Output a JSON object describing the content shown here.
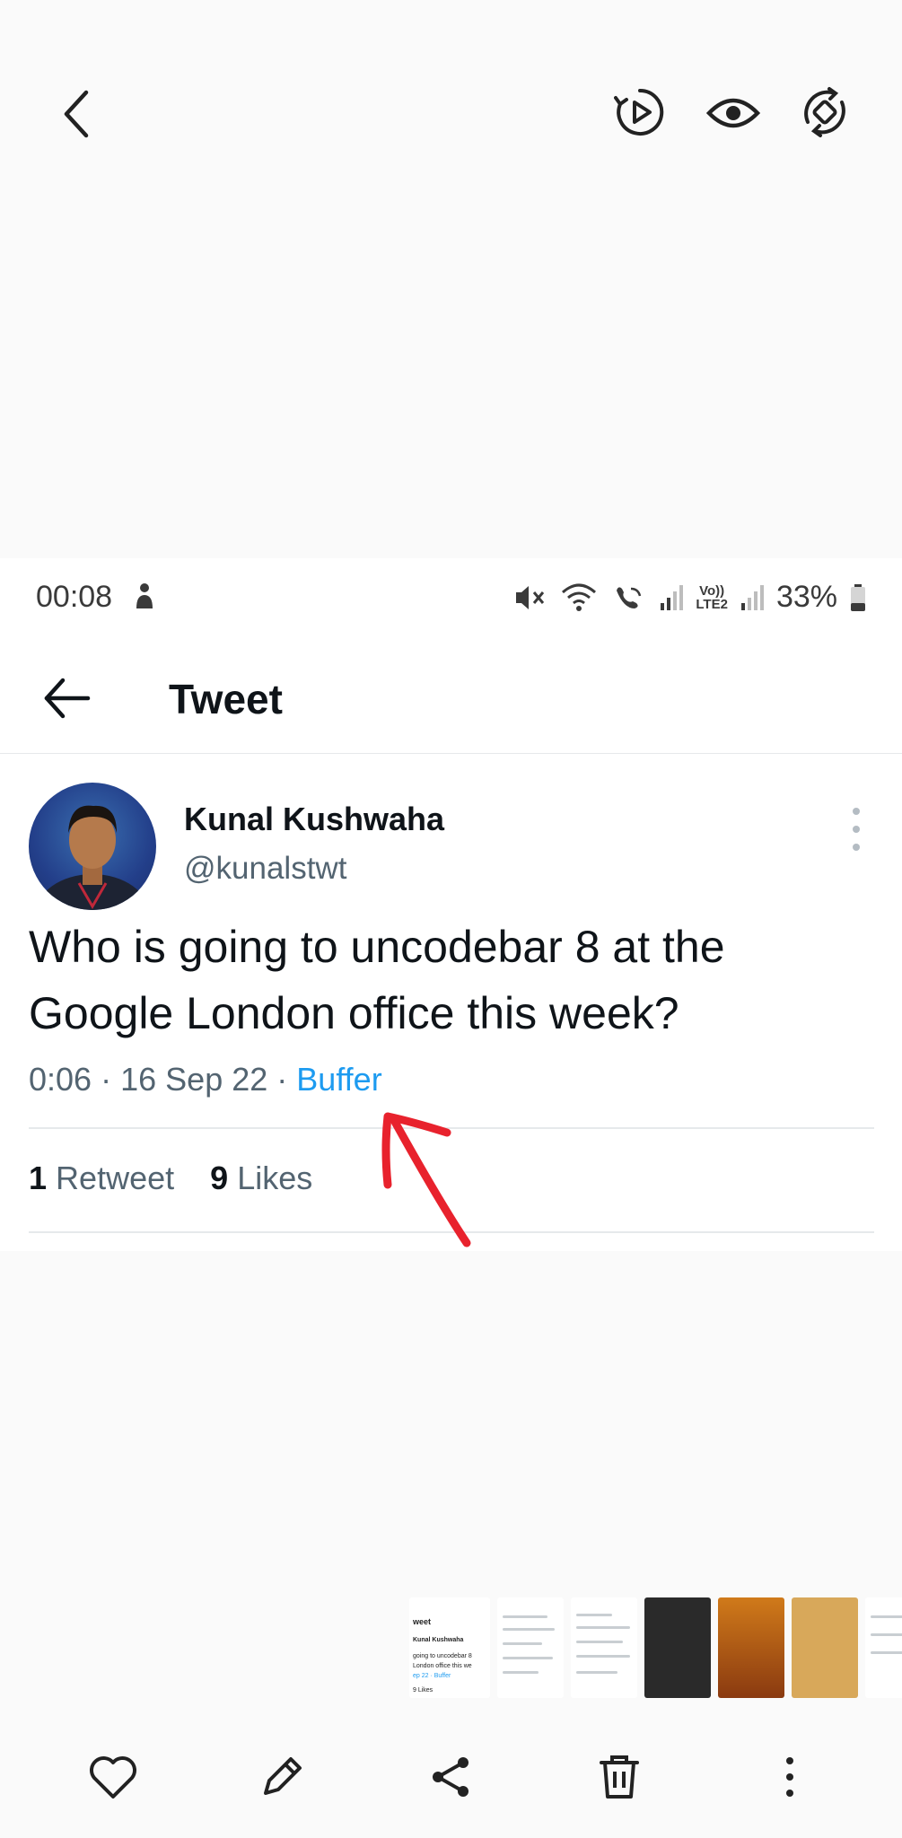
{
  "status_bar": {
    "time": "00:08",
    "lte_label_top": "Vo))",
    "lte_label_bottom": "LTE2",
    "battery": "33%"
  },
  "header": {
    "title": "Tweet"
  },
  "tweet": {
    "author_name": "Kunal Kushwaha",
    "author_handle": "@kunalstwt",
    "text": "Who is going to uncodebar 8 at the Google London office this week?",
    "time": "0:06",
    "date": "16 Sep 22",
    "separator": "·",
    "source": "Buffer",
    "retweet_count": "1",
    "retweet_label": "Retweet",
    "like_count": "9",
    "like_label": "Likes"
  },
  "thumbnail_strip": {
    "first": {
      "title": "weet",
      "author": "Kunal Kushwaha",
      "line1": "going to uncodebar 8",
      "line2": "London office this we",
      "meta": "ep 22 · Buffer",
      "likes": "9 Likes"
    }
  },
  "colors": {
    "accent": "#1d9bf0",
    "annotation": "#e8222d",
    "text_primary": "#0f1419",
    "text_secondary": "#536471"
  },
  "icons": {
    "viewer": [
      "chevron-left-icon",
      "video-play-icon",
      "eye-icon",
      "rotate-icon"
    ],
    "bottom": [
      "heart-icon",
      "pencil-icon",
      "share-icon",
      "trash-icon",
      "more-vertical-icon"
    ]
  }
}
